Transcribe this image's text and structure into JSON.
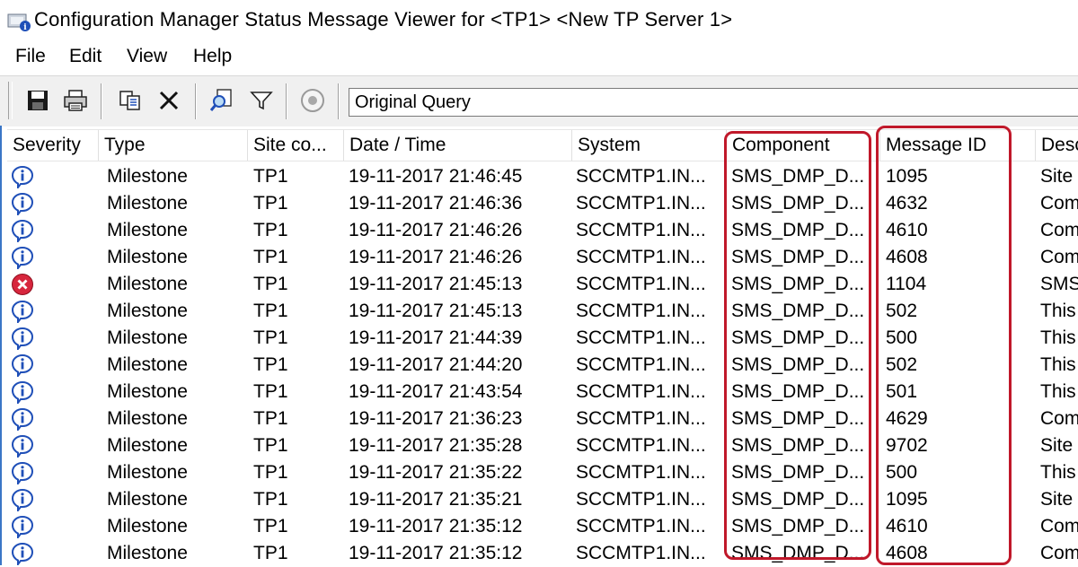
{
  "window": {
    "title": "Configuration Manager Status Message Viewer for <TP1> <New TP Server 1>"
  },
  "menu": [
    "File",
    "Edit",
    "View",
    "Help"
  ],
  "toolbar": {
    "buttons": [
      "save-icon",
      "print-icon",
      "copy-icon",
      "delete-icon",
      "find-icon",
      "filter-icon",
      "stop-icon"
    ],
    "query_value": "Original Query"
  },
  "columns": [
    "Severity",
    "Type",
    "Site co...",
    "Date / Time",
    "System",
    "Component",
    "Message ID",
    "Desc"
  ],
  "rows": [
    {
      "severity": "info",
      "type": "Milestone",
      "site": "TP1",
      "datetime": "19-11-2017 21:46:45",
      "system": "SCCMTP1.IN...",
      "component": "SMS_DMP_D...",
      "message_id": "1095",
      "desc": "Site"
    },
    {
      "severity": "info",
      "type": "Milestone",
      "site": "TP1",
      "datetime": "19-11-2017 21:46:36",
      "system": "SCCMTP1.IN...",
      "component": "SMS_DMP_D...",
      "message_id": "4632",
      "desc": "Com"
    },
    {
      "severity": "info",
      "type": "Milestone",
      "site": "TP1",
      "datetime": "19-11-2017 21:46:26",
      "system": "SCCMTP1.IN...",
      "component": "SMS_DMP_D...",
      "message_id": "4610",
      "desc": "Com"
    },
    {
      "severity": "info",
      "type": "Milestone",
      "site": "TP1",
      "datetime": "19-11-2017 21:46:26",
      "system": "SCCMTP1.IN...",
      "component": "SMS_DMP_D...",
      "message_id": "4608",
      "desc": "Com"
    },
    {
      "severity": "error",
      "type": "Milestone",
      "site": "TP1",
      "datetime": "19-11-2017 21:45:13",
      "system": "SCCMTP1.IN...",
      "component": "SMS_DMP_D...",
      "message_id": "1104",
      "desc": "SMS"
    },
    {
      "severity": "info",
      "type": "Milestone",
      "site": "TP1",
      "datetime": "19-11-2017 21:45:13",
      "system": "SCCMTP1.IN...",
      "component": "SMS_DMP_D...",
      "message_id": "502",
      "desc": "This"
    },
    {
      "severity": "info",
      "type": "Milestone",
      "site": "TP1",
      "datetime": "19-11-2017 21:44:39",
      "system": "SCCMTP1.IN...",
      "component": "SMS_DMP_D...",
      "message_id": "500",
      "desc": "This"
    },
    {
      "severity": "info",
      "type": "Milestone",
      "site": "TP1",
      "datetime": "19-11-2017 21:44:20",
      "system": "SCCMTP1.IN...",
      "component": "SMS_DMP_D...",
      "message_id": "502",
      "desc": "This"
    },
    {
      "severity": "info",
      "type": "Milestone",
      "site": "TP1",
      "datetime": "19-11-2017 21:43:54",
      "system": "SCCMTP1.IN...",
      "component": "SMS_DMP_D...",
      "message_id": "501",
      "desc": "This"
    },
    {
      "severity": "info",
      "type": "Milestone",
      "site": "TP1",
      "datetime": "19-11-2017 21:36:23",
      "system": "SCCMTP1.IN...",
      "component": "SMS_DMP_D...",
      "message_id": "4629",
      "desc": "Com"
    },
    {
      "severity": "info",
      "type": "Milestone",
      "site": "TP1",
      "datetime": "19-11-2017 21:35:28",
      "system": "SCCMTP1.IN...",
      "component": "SMS_DMP_D...",
      "message_id": "9702",
      "desc": "Site"
    },
    {
      "severity": "info",
      "type": "Milestone",
      "site": "TP1",
      "datetime": "19-11-2017 21:35:22",
      "system": "SCCMTP1.IN...",
      "component": "SMS_DMP_D...",
      "message_id": "500",
      "desc": "This"
    },
    {
      "severity": "info",
      "type": "Milestone",
      "site": "TP1",
      "datetime": "19-11-2017 21:35:21",
      "system": "SCCMTP1.IN...",
      "component": "SMS_DMP_D...",
      "message_id": "1095",
      "desc": "Site"
    },
    {
      "severity": "info",
      "type": "Milestone",
      "site": "TP1",
      "datetime": "19-11-2017 21:35:12",
      "system": "SCCMTP1.IN...",
      "component": "SMS_DMP_D...",
      "message_id": "4610",
      "desc": "Com"
    },
    {
      "severity": "info",
      "type": "Milestone",
      "site": "TP1",
      "datetime": "19-11-2017 21:35:12",
      "system": "SCCMTP1.IN...",
      "component": "SMS_DMP_D...",
      "message_id": "4608",
      "desc": "Com"
    }
  ],
  "colors": {
    "highlight": "#c0182a",
    "info_icon": "#1f4fb8",
    "error_icon": "#d7263d"
  }
}
